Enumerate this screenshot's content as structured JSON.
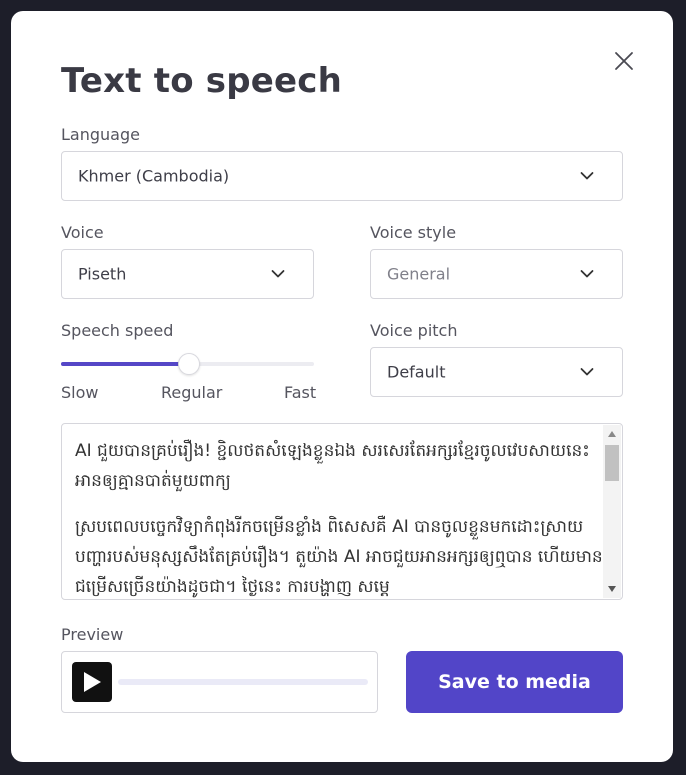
{
  "dialog": {
    "title": "Text to speech",
    "close_icon": "close-icon"
  },
  "language": {
    "label": "Language",
    "value": "Khmer (Cambodia)"
  },
  "voice": {
    "label": "Voice",
    "value": "Piseth"
  },
  "voice_style": {
    "label": "Voice style",
    "value": "General"
  },
  "speech_speed": {
    "label": "Speech speed",
    "min_label": "Slow",
    "mid_label": "Regular",
    "max_label": "Fast",
    "value_fraction": 0.5
  },
  "voice_pitch": {
    "label": "Voice pitch",
    "value": "Default"
  },
  "text": {
    "paragraph_1": "AI ជួយបានគ្រប់រឿង! ខ្ជិលថតសំឡេងខ្លួនឯង សរសេរតែអក្សរខ្មែរចូលវេបសាយនេះ អានឲ្យគ្មានបាត់មួយពាក្យ",
    "paragraph_2": "ស្របពេលបច្ចេកវិទ្យាកំពុងរីកចម្រើនខ្លាំង ពិសេសគឺ AI បានចូលខ្លួនមកដោះស្រាយបញ្ហារបស់មនុស្សសឹងតែគ្រប់រឿង។ តួយ៉ាង AI អាចជួយអានអក្សរឲ្យឮបាន ហើយមានជម្រើសច្រើនយ៉ាងដូចជា។ ថ្ងៃនេះ ការបង្ហាញ សម្ដេ"
  },
  "preview": {
    "label": "Preview",
    "play_icon": "play-icon",
    "progress_fraction": 0
  },
  "actions": {
    "save_label": "Save to media"
  },
  "colors": {
    "accent": "#5245c8",
    "backdrop": "#1d1e29"
  }
}
